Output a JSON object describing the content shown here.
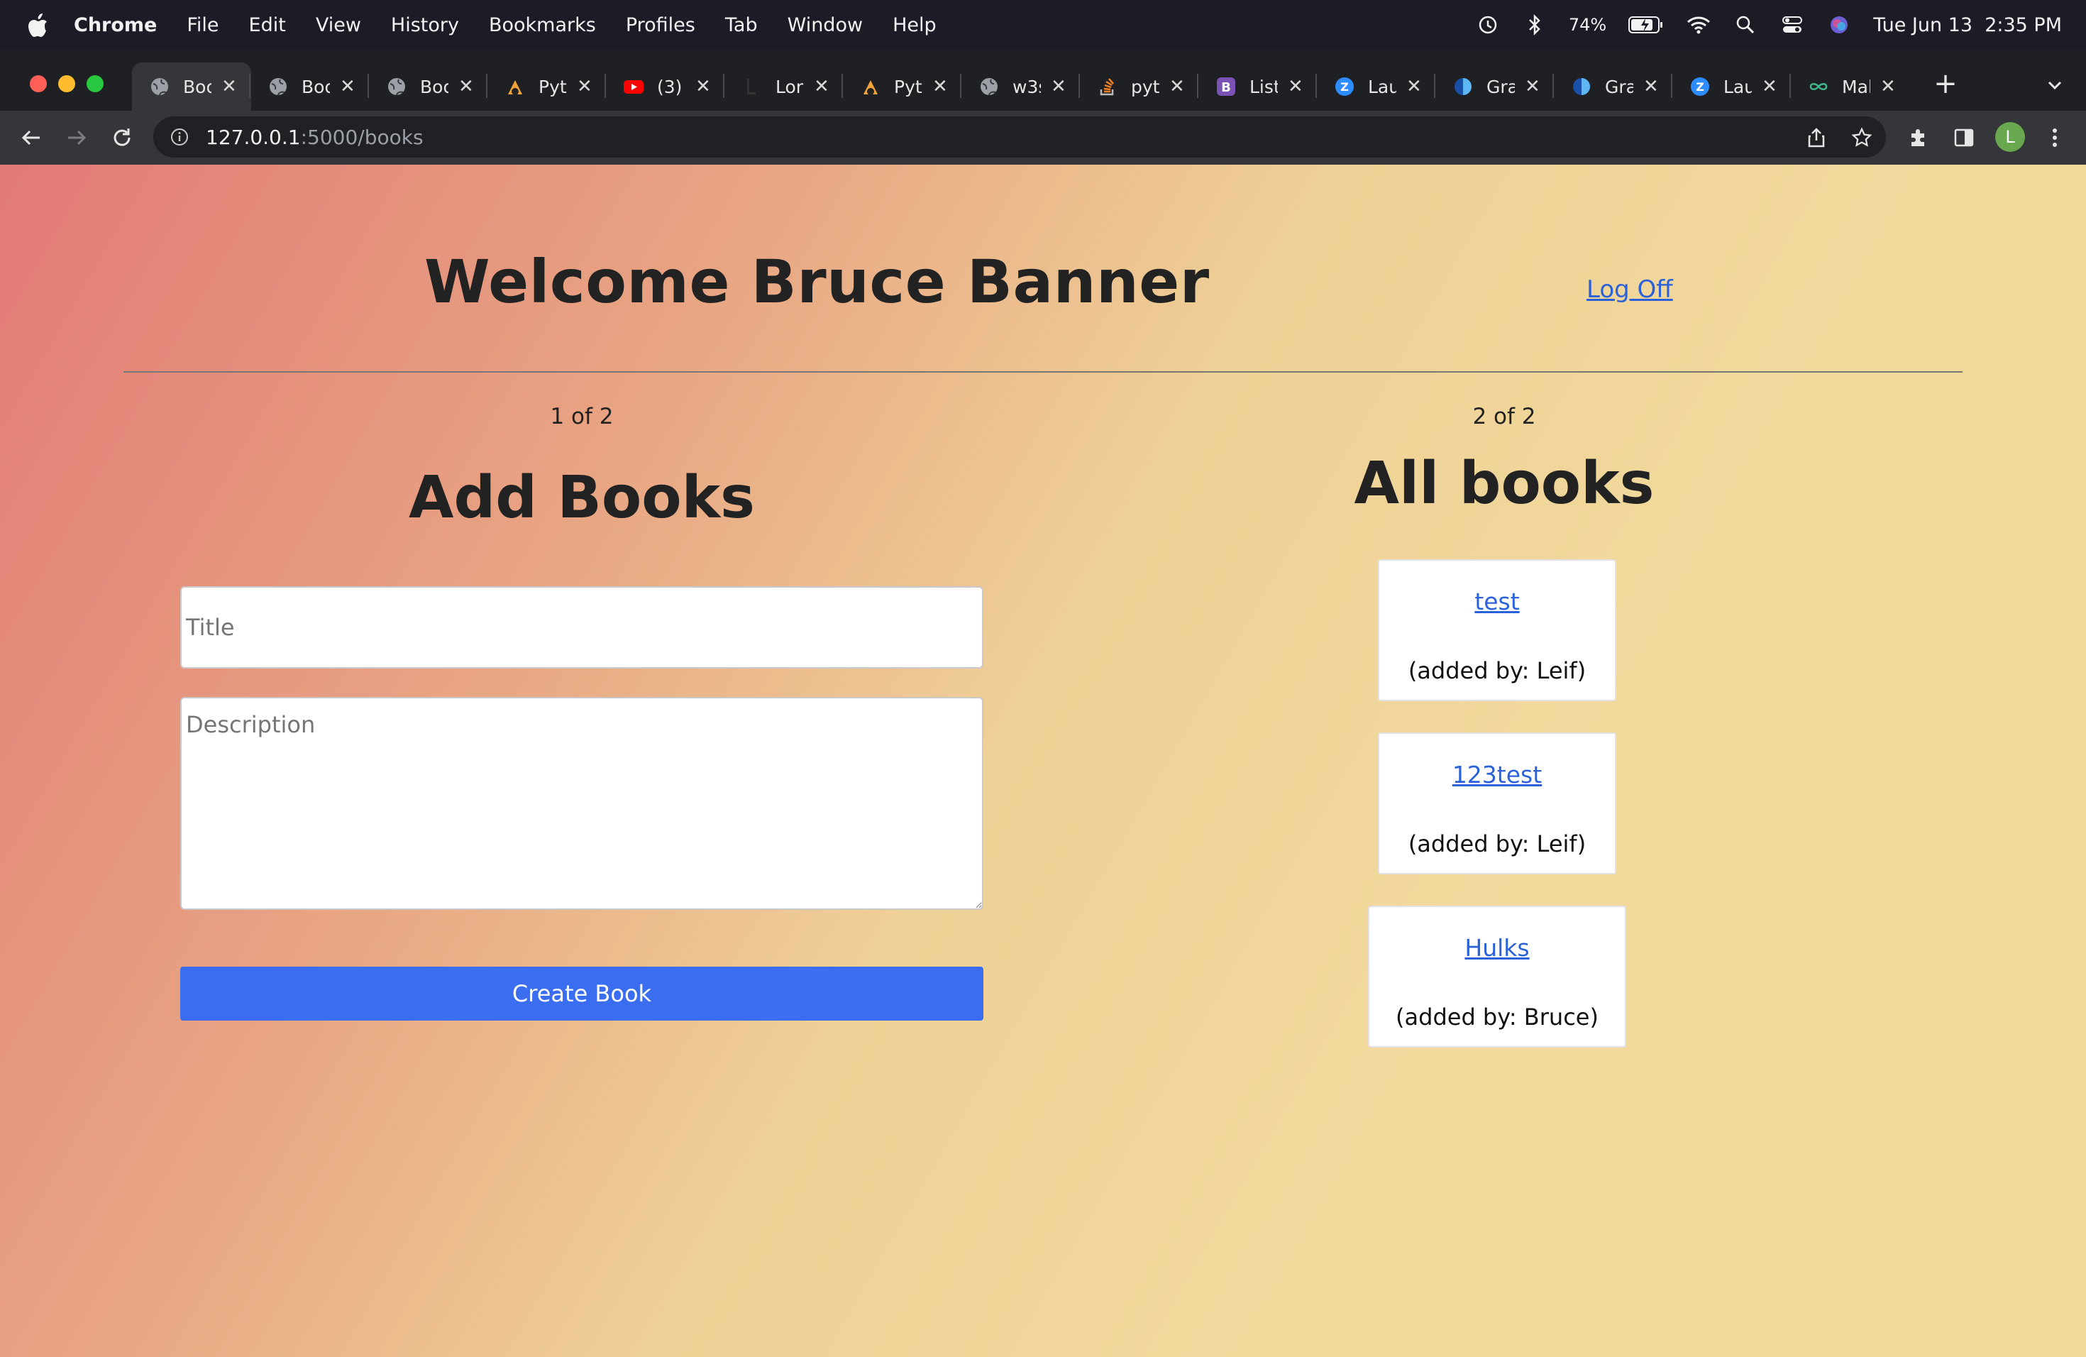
{
  "menubar": {
    "app_name": "Chrome",
    "items": [
      "File",
      "Edit",
      "View",
      "History",
      "Bookmarks",
      "Profiles",
      "Tab",
      "Window",
      "Help"
    ],
    "battery": "74%",
    "datetime": "Tue Jun 13  2:35 PM"
  },
  "tabs": [
    {
      "title": "Boo",
      "icon": "globe-icon"
    },
    {
      "title": "Boo",
      "icon": "globe-icon"
    },
    {
      "title": "Boo",
      "icon": "globe-icon"
    },
    {
      "title": "Pyt",
      "icon": "python-icon"
    },
    {
      "title": "(3)",
      "icon": "youtube-icon"
    },
    {
      "title": "Lor",
      "icon": "page-icon"
    },
    {
      "title": "Pyt",
      "icon": "python-icon"
    },
    {
      "title": "w3s",
      "icon": "globe-icon"
    },
    {
      "title": "pyt",
      "icon": "stackoverflow-icon"
    },
    {
      "title": "List",
      "icon": "bootstrap-icon"
    },
    {
      "title": "Lau",
      "icon": "zoom-icon"
    },
    {
      "title": "Gra",
      "icon": "planet-icon"
    },
    {
      "title": "Gra",
      "icon": "planet-icon"
    },
    {
      "title": "Lau",
      "icon": "zoom-icon"
    },
    {
      "title": "Mal",
      "icon": "infinity-icon"
    }
  ],
  "toolbar": {
    "url_host": "127.0.0.1",
    "url_path": ":5000/books",
    "avatar_letter": "L"
  },
  "page": {
    "welcome": "Welcome Bruce Banner",
    "logoff": "Log Off",
    "left_pager": "1 of 2",
    "right_pager": "2 of 2",
    "add_title": "Add Books",
    "title_placeholder": "Title",
    "description_placeholder": "Description",
    "create_button": "Create Book",
    "all_books_title": "All books",
    "books": [
      {
        "title": "test",
        "added_by": "(added by: Leif)"
      },
      {
        "title": "123test",
        "added_by": "(added by: Leif)"
      },
      {
        "title": "Hulks",
        "added_by": "(added by: Bruce)"
      }
    ]
  },
  "colors": {
    "accent_button": "#3a6df0",
    "link": "#2b62d9",
    "gradient_start": "#e27a76",
    "gradient_end": "#f1d99c"
  }
}
